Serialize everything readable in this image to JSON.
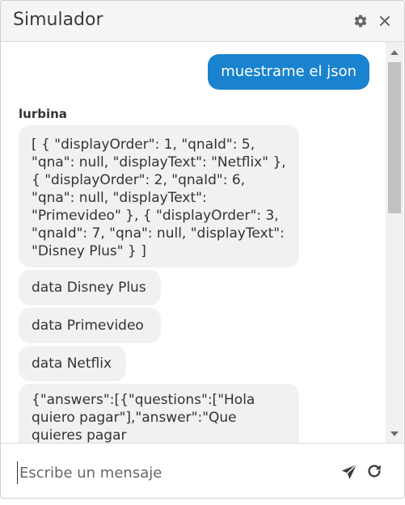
{
  "window": {
    "title": "Simulador"
  },
  "header_icons": [
    "gear-icon",
    "close-icon"
  ],
  "messages": {
    "user_message": "muestrame el json",
    "sender_name": "lurbina",
    "bot_json": "[ { \"displayOrder\": 1, \"qnaId\": 5, \"qna\": null, \"displayText\": \"Netflix\" }, { \"displayOrder\": 2, \"qnaId\": 6, \"qna\": null, \"displayText\": \"Primevideo\" }, { \"displayOrder\": 3, \"qnaId\": 7, \"qna\": null, \"displayText\": \"Disney Plus\" } ]",
    "bot_disney": "data Disney Plus",
    "bot_prime": "data Primevideo",
    "bot_netflix": "data Netflix",
    "bot_answers": "{\"answers\":[{\"questions\":[\"Hola quiero pagar\"],\"answer\":\"Que quieres pagar"
  },
  "composer": {
    "placeholder": "Escribe un mensaje",
    "value": ""
  },
  "composer_icons": [
    "send-icon",
    "refresh-icon"
  ],
  "colors": {
    "user_bubble": "#1a83cf",
    "bot_bubble": "#f1f1f1",
    "header_bg": "#f5f5f5"
  }
}
